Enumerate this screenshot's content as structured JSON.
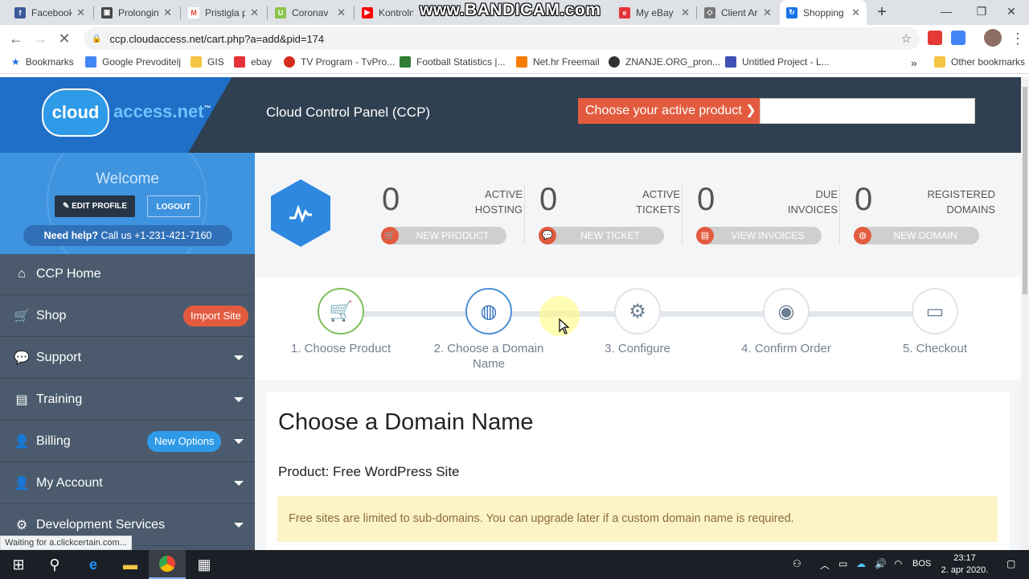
{
  "browser": {
    "tabs": [
      {
        "title": "Facebook",
        "color": "#3b5998",
        "glyph": "f"
      },
      {
        "title": "Prolongin",
        "color": "#444444",
        "glyph": "▣"
      },
      {
        "title": "Pristigla p",
        "color": "#ea4335",
        "glyph": "M"
      },
      {
        "title": "Coronav",
        "color": "#8bc34a",
        "glyph": "U"
      },
      {
        "title": "Kontroln",
        "color": "#ff0000",
        "glyph": "▶"
      },
      {
        "title": "My eBay",
        "color": "#e53238",
        "glyph": "e"
      },
      {
        "title": "Client Ar",
        "color": "#777777",
        "glyph": "◇"
      },
      {
        "title": "Shopping",
        "color": "#1a73e8",
        "glyph": "↻"
      }
    ],
    "new_tab": "+",
    "watermark": "www.BANDICAM.com",
    "window_controls": [
      "—",
      "❐",
      "✕"
    ],
    "url": "ccp.cloudaccess.net/cart.php?a=add&pid=174",
    "bookmarks": [
      {
        "label": "Bookmarks",
        "color": "#1a73e8"
      },
      {
        "label": "Google Prevoditelj",
        "color": "#4285f4"
      },
      {
        "label": "GIS",
        "color": "#f4c542"
      },
      {
        "label": "ebay",
        "color": "#e53238"
      },
      {
        "label": "TV Program - TvPro...",
        "color": "#d62b1f"
      },
      {
        "label": "Football Statistics |...",
        "color": "#2e7d32"
      },
      {
        "label": "Net.hr Freemail",
        "color": "#f57c00"
      },
      {
        "label": "ZNANJE.ORG_pron...",
        "color": "#333333"
      },
      {
        "label": "Untitled Project - L...",
        "color": "#3f51b5"
      }
    ],
    "bookmarks_overflow": "»",
    "other_bookmarks": "Other bookmarks",
    "status_text": "Waiting for a.clickcertain.com..."
  },
  "header": {
    "logo_cloud": "cloud",
    "logo_text": "access.net",
    "logo_tm": "™",
    "title": "Cloud Control Panel (CCP)",
    "product_selector": "Choose your active product ❯"
  },
  "sidebar": {
    "welcome": "Welcome",
    "edit_profile": "✎ EDIT PROFILE",
    "logout": "LOGOUT",
    "help_strong": "Need help?",
    "help_text": " Call us +1-231-421-7160",
    "items": [
      {
        "label": "CCP Home",
        "icon": "⌂"
      },
      {
        "label": "Shop",
        "icon": "🛒",
        "badge": "Import Site"
      },
      {
        "label": "Support",
        "icon": "💬"
      },
      {
        "label": "Training",
        "icon": "▤"
      },
      {
        "label": "Billing",
        "icon": "👤",
        "badge": "New Options"
      },
      {
        "label": "My Account",
        "icon": "👤"
      },
      {
        "label": "Development Services",
        "icon": "⚙"
      }
    ]
  },
  "stats": [
    {
      "value": "0",
      "label_l1": "ACTIVE",
      "label_l2": "HOSTING",
      "action": "NEW PRODUCT",
      "icon": "🛒"
    },
    {
      "value": "0",
      "label_l1": "ACTIVE",
      "label_l2": "TICKETS",
      "action": "NEW TICKET",
      "icon": "💬"
    },
    {
      "value": "0",
      "label_l1": "DUE",
      "label_l2": "INVOICES",
      "action": "VIEW INVOICES",
      "icon": "▤"
    },
    {
      "value": "0",
      "label_l1": "REGISTERED",
      "label_l2": "DOMAINS",
      "action": "NEW DOMAIN",
      "icon": "◍"
    }
  ],
  "steps": [
    {
      "label": "1. Choose Product",
      "icon": "🛒"
    },
    {
      "label": "2. Choose a Domain Name",
      "icon": "◍"
    },
    {
      "label": "3. Configure",
      "icon": "⚙"
    },
    {
      "label": "4. Confirm Order",
      "icon": "◉"
    },
    {
      "label": "5. Checkout",
      "icon": "▭"
    }
  ],
  "main": {
    "heading": "Choose a Domain Name",
    "product": "Product: Free WordPress Site",
    "alert": "Free sites are limited to sub-domains. You can upgrade later if a custom domain name is required."
  },
  "taskbar": {
    "lang": "BOS",
    "time": "23:17",
    "date": "2. apr 2020."
  },
  "colors": {
    "accent": "#e35b3f",
    "brand_blue": "#2e88e0",
    "sidebar": "#4b5b6d",
    "header": "#2f4050"
  }
}
